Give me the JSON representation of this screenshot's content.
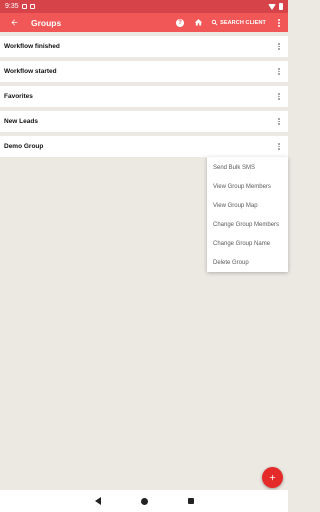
{
  "status_bar": {
    "time": "9:35"
  },
  "app_bar": {
    "title": "Groups",
    "search_label": "SEARCH CLIENT"
  },
  "groups": [
    {
      "label": "Workflow finished"
    },
    {
      "label": "Workflow started"
    },
    {
      "label": "Favorites"
    },
    {
      "label": "New Leads"
    },
    {
      "label": "Demo Group"
    }
  ],
  "context_menu": {
    "items": [
      "Send Bulk SMS",
      "View Group Members",
      "View Group Map",
      "Change Group Members",
      "Change Group Name",
      "Delete Group"
    ]
  },
  "colors": {
    "status_bar": "#d6444a",
    "app_bar": "#f25757",
    "fab": "#e52a2a",
    "background": "#ece8e2"
  },
  "icons": {
    "back": "arrow-left-icon",
    "help": "help-circle-icon",
    "home": "home-icon",
    "search": "search-icon",
    "overflow": "more-vert-icon",
    "fab": "plus-icon"
  }
}
